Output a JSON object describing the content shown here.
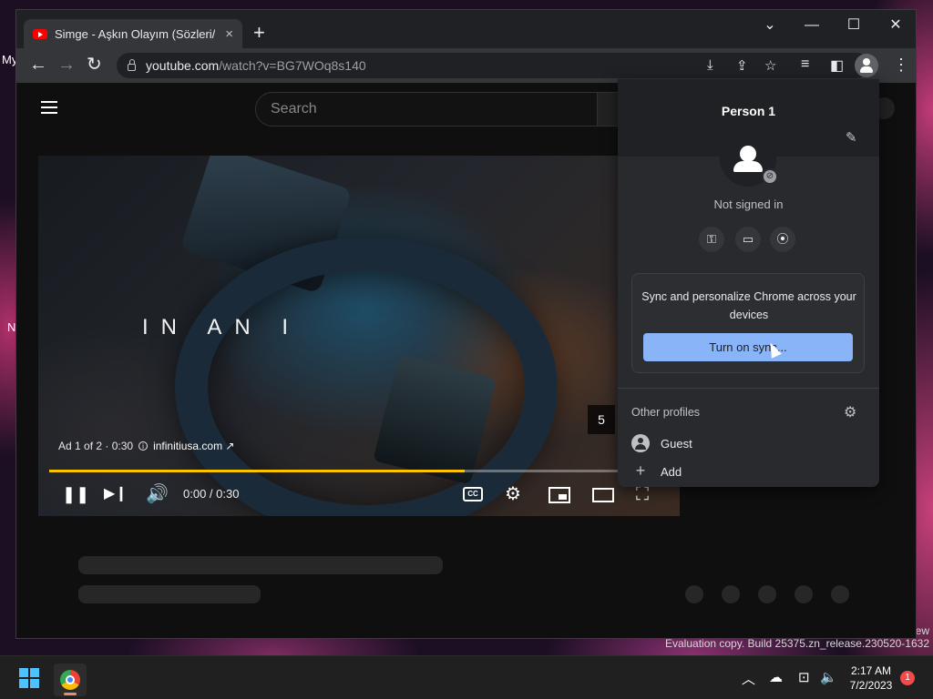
{
  "desktop": {
    "fragment_top": "My",
    "fragment_mid": "N",
    "fragment_right": "ew",
    "watermark": "Evaluation copy. Build 25375.zn_release.230520-1632"
  },
  "tab": {
    "title": "Simge - Aşkın Olayım (Sözleri/Lyrics)",
    "close_icon": "×",
    "new_tab_icon": "+"
  },
  "window_controls": {
    "dropdown": "⌄",
    "minimize": "—",
    "maximize": "☐",
    "close": "✕"
  },
  "toolbar": {
    "back_icon": "←",
    "forward_icon": "→",
    "reload_icon": "↻",
    "url_host": "youtube.com",
    "url_path": "/watch?v=BG7WOq8s140",
    "install_icon": "⤓",
    "share_icon": "⇪",
    "bookmark_icon": "☆",
    "media_icon": "≡",
    "sidepanel_icon": "◧",
    "menu_icon": "⋮"
  },
  "youtube": {
    "search_placeholder": "Search"
  },
  "player": {
    "headline": "IN AN I",
    "ad_label": "Ad 1 of 2 · 0:30",
    "ad_info_icon": "i",
    "ad_link": "infinitiusa.com ↗",
    "ad_countdown": "5",
    "progress_fraction": 0.67,
    "time": "0:00 / 0:30",
    "pause_icon": "❚❚",
    "next_icon": "▶❙",
    "volume_icon": "🔊",
    "cc_label": "CC",
    "settings_icon": "⚙",
    "fullscreen_icon": "⛶"
  },
  "profile_popup": {
    "name": "Person 1",
    "edit_icon": "✎",
    "badge_icon": "⊘",
    "status": "Not signed in",
    "passwords_icon": "⚿",
    "payments_icon": "▭",
    "addresses_icon": "⦿",
    "sync_text": "Sync and personalize Chrome across your devices",
    "sync_button": "Turn on sync...",
    "other_profiles": "Other profiles",
    "settings_icon": "⚙",
    "guest_label": "Guest",
    "add_label": "Add",
    "add_icon": "+"
  },
  "taskbar": {
    "chevron_icon": "︿",
    "cloud_icon": "☁",
    "network_icon": "⊡",
    "volume_icon": "🔈",
    "time": "2:17 AM",
    "date": "7/2/2023",
    "notification_count": "1"
  }
}
